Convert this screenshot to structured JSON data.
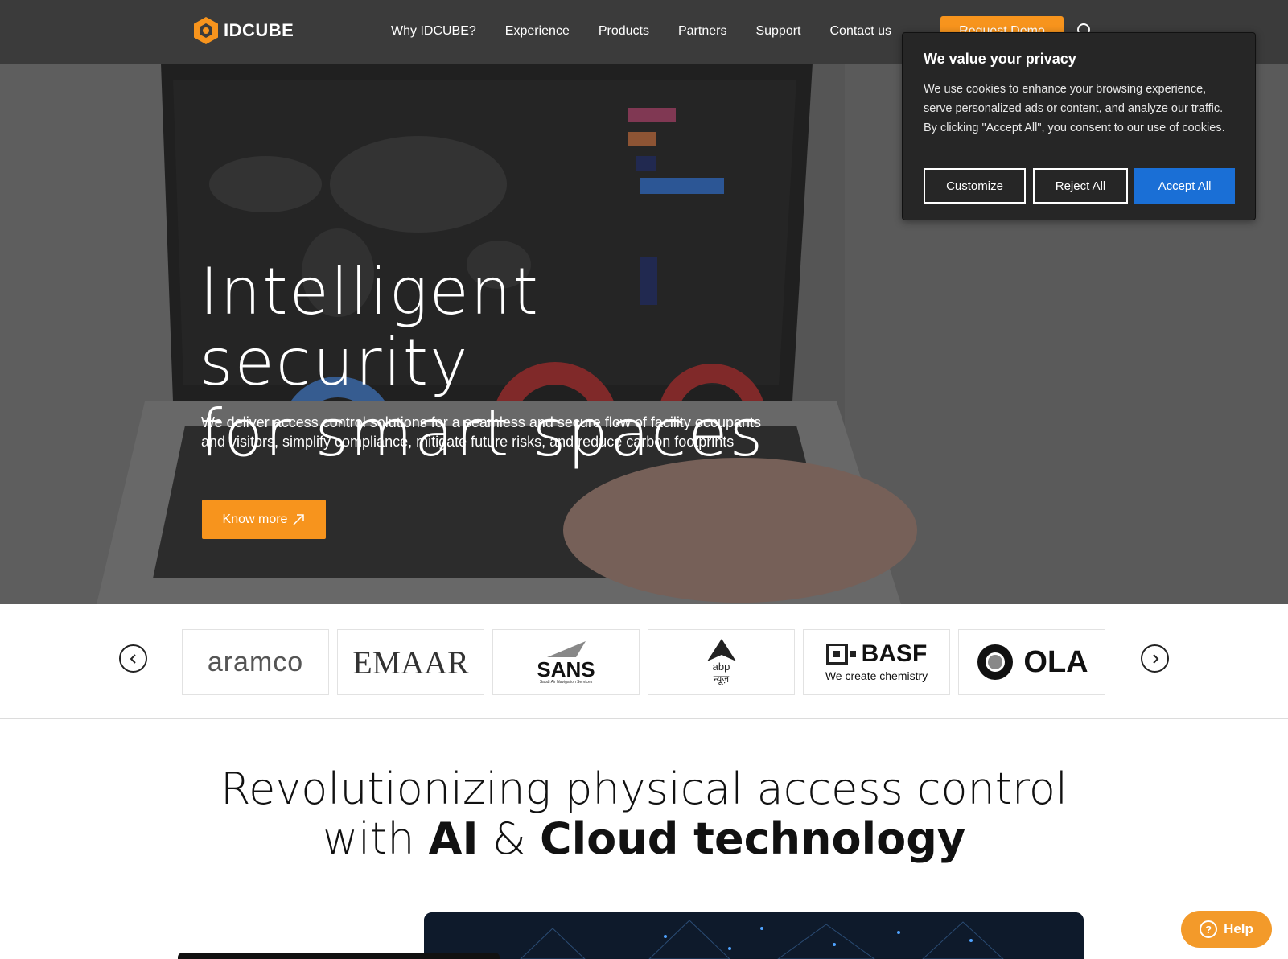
{
  "brand": {
    "name": "IDCUBE",
    "accent": "#f7941d"
  },
  "nav": {
    "items": [
      "Why IDCUBE?",
      "Experience",
      "Products",
      "Partners",
      "Support",
      "Contact us"
    ],
    "demo_label": "Request Demo",
    "search_icon": "search-icon"
  },
  "hero": {
    "title_line1": "Intelligent security",
    "title_line2": "for smart spaces",
    "subtitle": "We deliver access control solutions for a seamless and secure flow of facility occupants and visitors, simplify compliance, mitigate future risks, and reduce carbon footprints",
    "cta_label": "Know more",
    "cta_icon": "arrow-up-right-icon"
  },
  "cookie": {
    "title": "We value your privacy",
    "text": "We use cookies to enhance your browsing experience, serve personalized ads or content, and analyze our traffic. By clicking \"Accept All\", you consent to our use of cookies.",
    "customize_label": "Customize",
    "reject_label": "Reject All",
    "accept_label": "Accept All",
    "accept_color": "#1a6fd6"
  },
  "clients": {
    "prev_icon": "chevron-left-icon",
    "next_icon": "chevron-right-icon",
    "logos": [
      {
        "name": "aramco",
        "text": "aramco"
      },
      {
        "name": "emaar",
        "text": "EMAAR"
      },
      {
        "name": "sans",
        "text": "SANS",
        "subtext": "Saudi Air Navigation Services"
      },
      {
        "name": "abp",
        "text": "abp",
        "subtext": "न्यूज़"
      },
      {
        "name": "basf",
        "text": "BASF",
        "subtext": "We create chemistry"
      },
      {
        "name": "ola",
        "text": "OLA"
      }
    ]
  },
  "section": {
    "line1": "Revolutionizing physical access control",
    "line2_prefix": "with ",
    "line2_bold1": "AI",
    "line2_mid": " & ",
    "line2_bold2": "Cloud technology"
  },
  "help": {
    "label": "Help",
    "icon": "question-circle-icon"
  }
}
